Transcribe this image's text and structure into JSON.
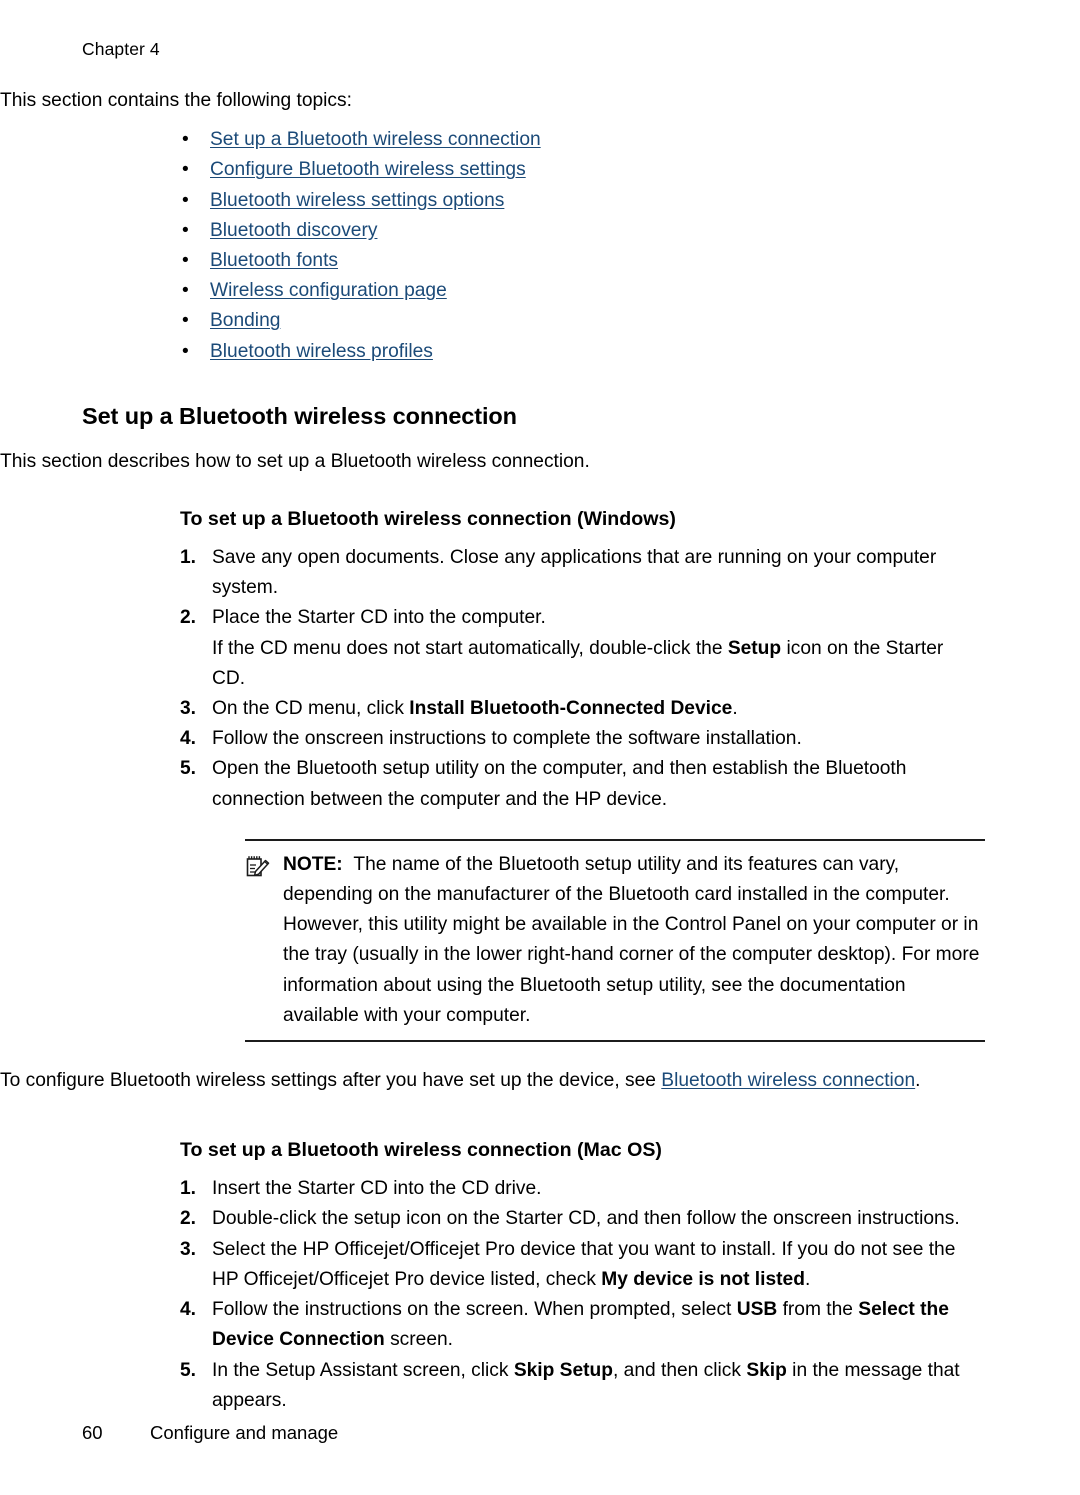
{
  "header": {
    "chapter": "Chapter 4"
  },
  "intro": {
    "lead": "This section contains the following topics:",
    "bullet_glyph": "•",
    "links": [
      "Set up a Bluetooth wireless connection",
      "Configure Bluetooth wireless settings",
      "Bluetooth wireless settings options",
      "Bluetooth discovery",
      "Bluetooth fonts",
      "Wireless configuration page",
      "Bonding",
      "Bluetooth wireless profiles"
    ]
  },
  "section": {
    "title": "Set up a Bluetooth wireless connection",
    "intro": "This section describes how to set up a Bluetooth wireless connection."
  },
  "windows": {
    "heading": "To set up a Bluetooth wireless connection (Windows)",
    "steps": [
      {
        "num": "1.",
        "text_1": "Save any open documents. Close any applications that are running on your computer system."
      },
      {
        "num": "2.",
        "text_1": "Place the Starter CD into the computer.",
        "cont_a": "If the CD menu does not start automatically, double-click the ",
        "cont_b": "Setup",
        "cont_c": " icon on the Starter CD."
      },
      {
        "num": "3.",
        "text_1": "On the CD menu, click ",
        "bold_1": "Install Bluetooth-Connected Device",
        "text_2": "."
      },
      {
        "num": "4.",
        "text_1": "Follow the onscreen instructions to complete the software installation."
      },
      {
        "num": "5.",
        "text_1": "Open the Bluetooth setup utility on the computer, and then establish the Bluetooth connection between the computer and the HP device."
      }
    ]
  },
  "note": {
    "icon": "note-pad-pencil-icon",
    "label": "NOTE:",
    "body": "The name of the Bluetooth setup utility and its features can vary, depending on the manufacturer of the Bluetooth card installed in the computer. However, this utility might be available in the Control Panel on your computer or in the tray (usually in the lower right-hand corner of the computer desktop). For more information about using the Bluetooth setup utility, see the documentation available with your computer."
  },
  "after_note": {
    "text_before": "To configure Bluetooth wireless settings after you have set up the device, see ",
    "link": "Bluetooth wireless connection",
    "text_after": "."
  },
  "mac": {
    "heading": "To set up a Bluetooth wireless connection (Mac OS)",
    "steps": [
      {
        "num": "1.",
        "text_1": "Insert the Starter CD into the CD drive."
      },
      {
        "num": "2.",
        "text_1": "Double-click the setup icon on the Starter CD, and then follow the onscreen instructions."
      },
      {
        "num": "3.",
        "text_1": "Select the HP Officejet/Officejet Pro device that you want to install. If you do not see the HP Officejet/Officejet Pro device listed, check ",
        "bold_1": "My device is not listed",
        "text_2": "."
      },
      {
        "num": "4.",
        "text_1": "Follow the instructions on the screen. When prompted, select ",
        "bold_1": "USB",
        "text_2": " from the ",
        "bold_2": "Select the Device Connection",
        "text_3": " screen."
      },
      {
        "num": "5.",
        "text_1": "In the Setup Assistant screen, click ",
        "bold_1": "Skip Setup",
        "text_2": ", and then click ",
        "bold_2": "Skip",
        "text_3": " in the message that appears."
      }
    ]
  },
  "footer": {
    "page_number": "60",
    "section_name": "Configure and manage"
  },
  "colors": {
    "link": "#1b4a78",
    "text": "#000000",
    "rule": "#1c1c1c",
    "background": "#ffffff"
  }
}
